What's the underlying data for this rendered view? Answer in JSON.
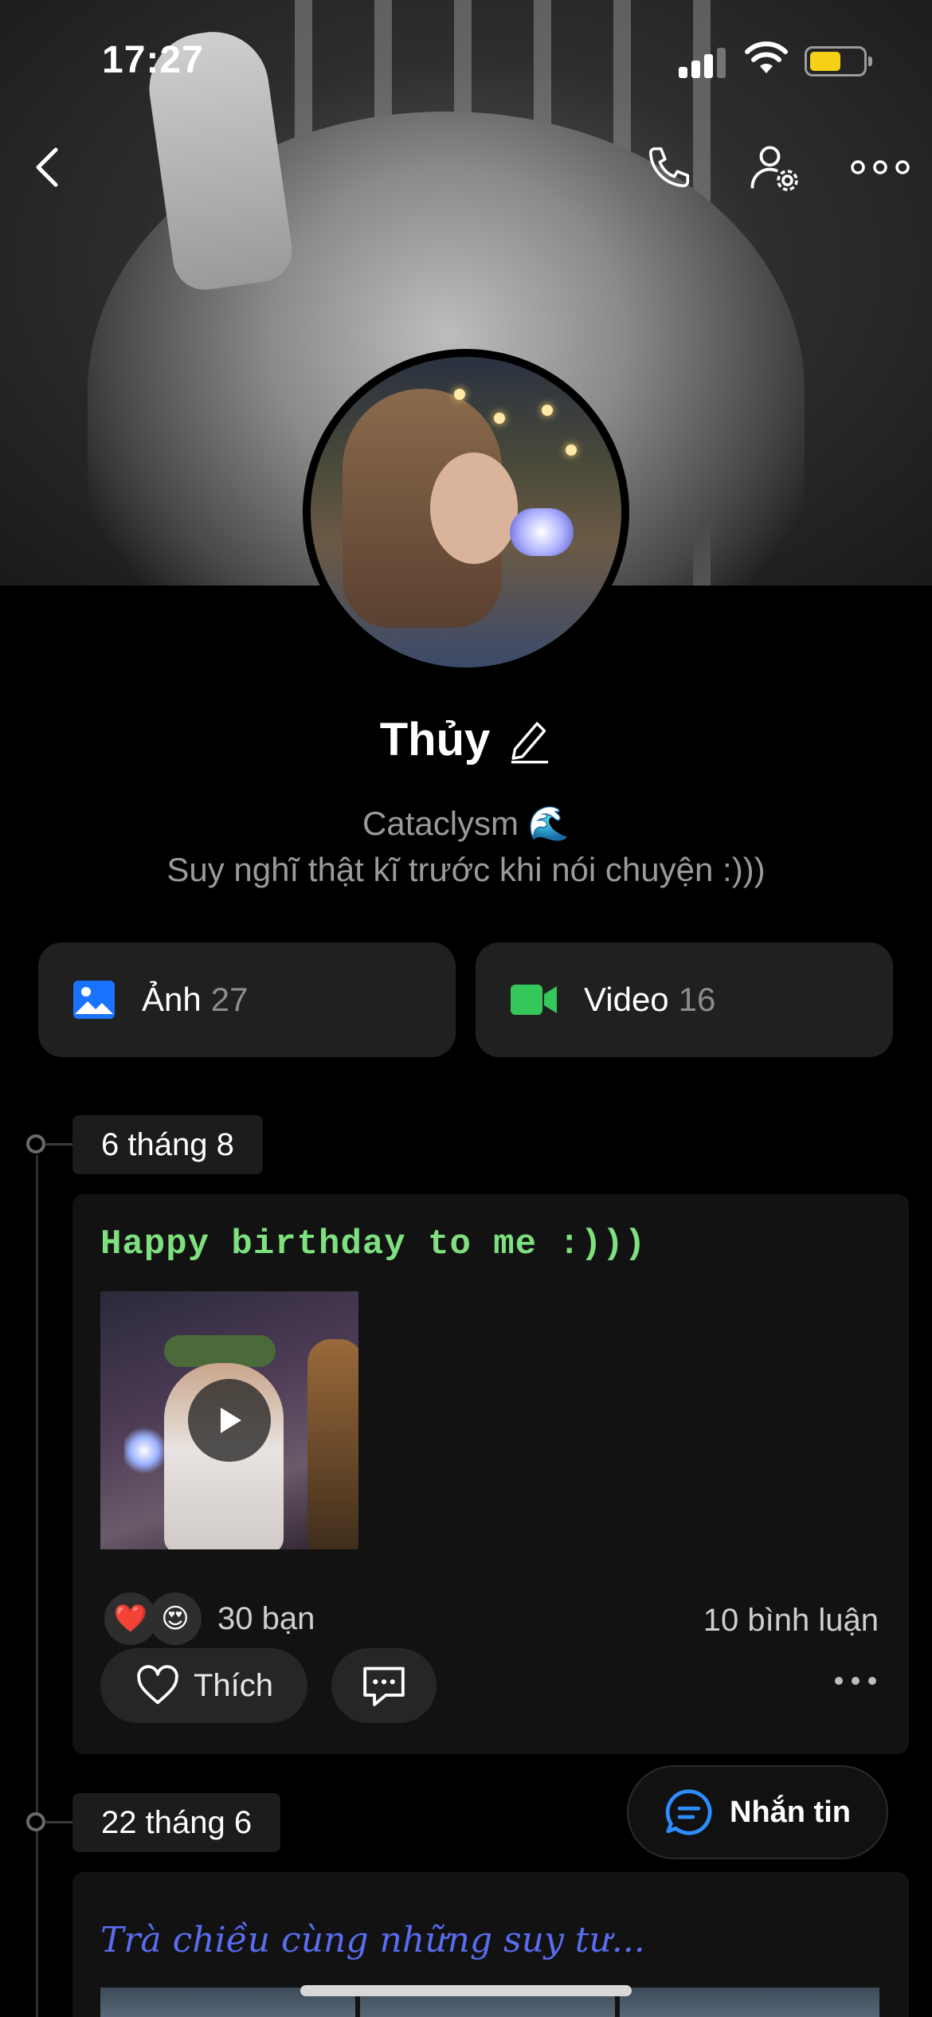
{
  "status_bar": {
    "time": "17:27",
    "battery_level": 0.6,
    "battery_color": "#f5d016"
  },
  "nav": {
    "back_icon": "chevron-left-icon",
    "call_icon": "phone-icon",
    "settings_icon": "user-gear-icon",
    "more_icon": "more-dots-icon"
  },
  "profile": {
    "name": "Thủy",
    "edit_icon": "pencil-icon",
    "bio_line1": "Cataclysm 🌊",
    "bio_line2": "Suy nghĩ thật kĩ trước khi nói chuyện :)))"
  },
  "media": {
    "photos": {
      "label": "Ảnh",
      "count": "27",
      "icon": "image-icon",
      "color": "#1a73ff"
    },
    "videos": {
      "label": "Video",
      "count": "16",
      "icon": "video-camera-icon",
      "color": "#34c759"
    }
  },
  "timeline": [
    {
      "date": "6 tháng 8",
      "post": {
        "text": "Happy birthday to me :)))",
        "text_color": "#7ee07e",
        "reactions": [
          "❤️",
          "😍"
        ],
        "reaction_count": "30 bạn",
        "comment_count": "10 bình luận",
        "like_label": "Thích"
      }
    },
    {
      "date": "22 tháng 6",
      "post": {
        "text": "Trà chiều cùng những suy tư...",
        "text_color": "#5a6cf0"
      }
    }
  ],
  "message_button": {
    "label": "Nhắn tin",
    "icon": "chat-bubble-icon"
  }
}
